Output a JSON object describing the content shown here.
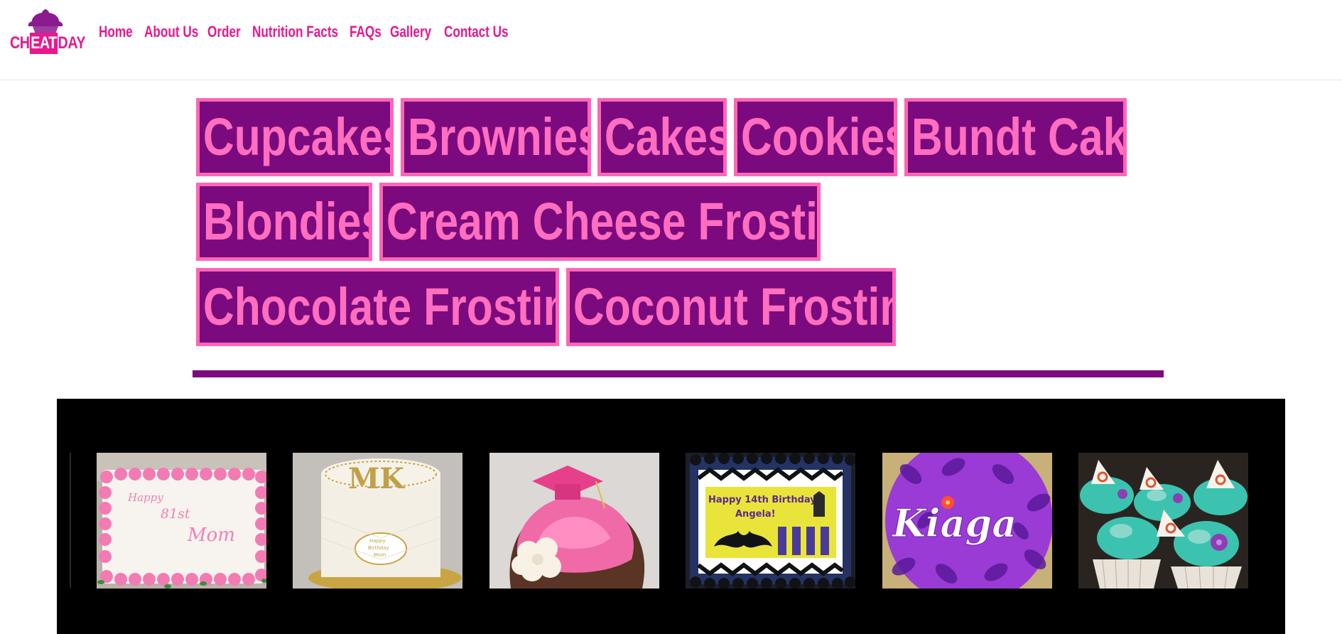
{
  "logo": {
    "text_before": "CH",
    "text_highlight": "EAT",
    "text_after": "DAY",
    "icon": "cupcake-icon",
    "colors": {
      "brand_pink": "#e6198f",
      "brand_purple": "#8c1b8f"
    }
  },
  "nav": {
    "items": [
      {
        "label": "Home"
      },
      {
        "label": "About Us"
      },
      {
        "label": "Order"
      },
      {
        "label": "Nutrition Facts"
      },
      {
        "label": "FAQs"
      },
      {
        "label": "Gallery"
      },
      {
        "label": "Contact Us"
      }
    ]
  },
  "categories": {
    "tile_colors": {
      "background": "#7b0a7f",
      "border": "#ff66b6",
      "text": "#ff6ebf"
    },
    "items": [
      {
        "label": "Cupcakes"
      },
      {
        "label": "Brownies"
      },
      {
        "label": "Cakes"
      },
      {
        "label": "Cookies"
      },
      {
        "label": "Bundt Cake"
      },
      {
        "label": "Blondies"
      },
      {
        "label": "Cream Cheese Frosting"
      },
      {
        "label": "Chocolate Frosting"
      },
      {
        "label": "Coconut Frosting"
      }
    ]
  },
  "gallery": {
    "background": "#000000",
    "photos": [
      {
        "subject": "rose-border-sheet-cake",
        "text_lines": [
          "Happy",
          "81st",
          "Mom"
        ]
      },
      {
        "subject": "mk-birthday-cake",
        "text_lines": [
          "MK",
          "Happy",
          "Birthday",
          "Mom"
        ]
      },
      {
        "subject": "graduation-cap-cupcake",
        "text_lines": []
      },
      {
        "subject": "batman-birthday-cake",
        "text_lines": [
          "Happy 14th Birthday",
          "Angela!"
        ]
      },
      {
        "subject": "kiaga-stencil-cake",
        "text_lines": [
          "Kiaga"
        ]
      },
      {
        "subject": "moana-teal-cupcakes",
        "text_lines": []
      }
    ]
  }
}
